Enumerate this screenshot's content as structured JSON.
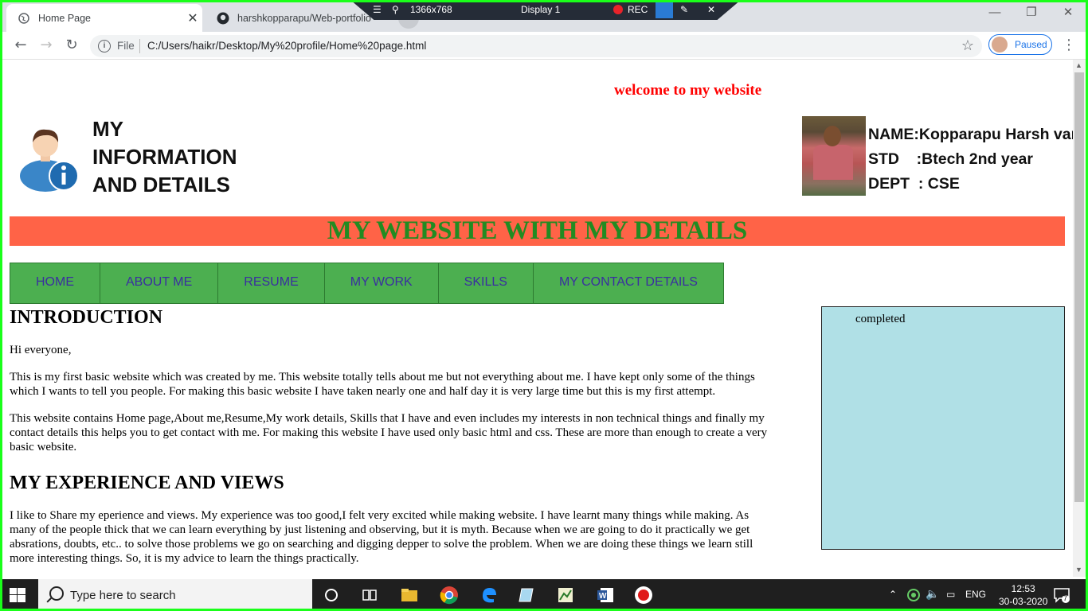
{
  "browser": {
    "tabs": [
      {
        "title": "Home Page",
        "active": true
      },
      {
        "title": "harshkopparapu/Web-portfolio",
        "active": false
      }
    ],
    "address": {
      "scheme_label": "File",
      "url": "C:/Users/haikr/Desktop/My%20profile/Home%20page.html"
    },
    "profile_label": "Paused"
  },
  "recorder": {
    "resolution": "1366x768",
    "display": "Display 1",
    "rec": "REC"
  },
  "page": {
    "welcome": "welcome to my website",
    "info_title_lines": [
      "MY",
      "INFORMATION",
      "AND DETAILS"
    ],
    "details": {
      "name": "NAME:Kopparapu Harsh vardan",
      "std": "STD    :Btech 2nd year",
      "dept": "DEPT  : CSE"
    },
    "banner": "MY WEBSITE WITH MY DETAILS",
    "nav": [
      "HOME",
      "ABOUT ME",
      "RESUME",
      "MY WORK",
      "SKILLS",
      "MY CONTACT DETAILS"
    ],
    "intro_heading": "INTRODUCTION",
    "greeting": "Hi everyone,",
    "para1": "This is my first basic website which was created by me. This website totally tells about me but not everything about me. I have kept only some of the things which I wants to tell you people. For making this basic website I have taken nearly one and half day it is very large time but this is my first attempt.",
    "para2": "This website contains Home page,About me,Resume,My work details, Skills that I have and even includes my interests in non technical things and finally my contact details this helps you to get contact with me. For making this website I have used only basic html and css. These are more than enough to create a very basic website.",
    "experience_heading": "MY EXPERIENCE AND VIEWS",
    "para3": "I like to Share my eperience and views. My experience was too good,I felt very excited while making website. I have learnt many things while making. As many of the people thick that we can learn everything by just listening and observing, but it is myth. Because when we are going to do it practically we get absrations, doubts, etc.. to solve those problems we go on searching and digging depper to solve the problem. When we are doing these things we learn still more interesting things. So, it is my advice to learn the things practically.",
    "sidebar_label": "completed"
  },
  "taskbar": {
    "search_placeholder": "Type here to search",
    "language": "ENG",
    "time": "12:53",
    "date": "30-03-2020",
    "notification_count": "7"
  }
}
